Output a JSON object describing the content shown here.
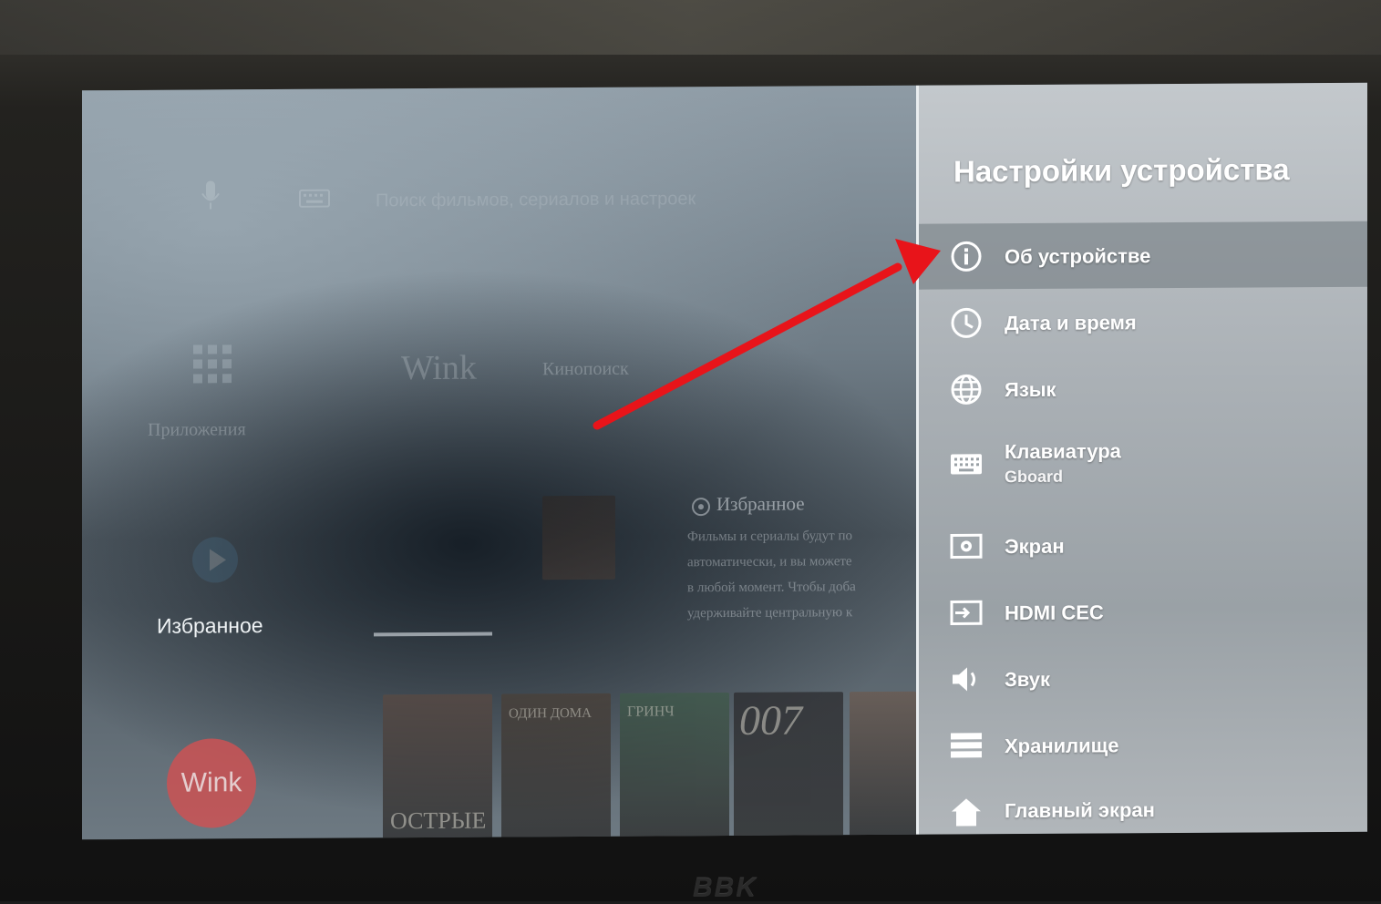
{
  "launcher": {
    "search_hint": "Поиск фильмов, сериалов и настроек",
    "apps_label": "Приложения",
    "row_title_wink": "Wink",
    "row_title_2": "Кинопоиск",
    "favorites_label": "Избранное",
    "favorites_panel": {
      "title": "Избранное",
      "description": "Фильмы и сериалы будут по\nавтоматически, и вы можете\nв любой момент. Чтобы доба\nудерживайте центральную к"
    },
    "posters": [
      {
        "name": "poster-1",
        "text": "ОСТРЫЕ",
        "color": "#5a4a43"
      },
      {
        "name": "poster-2",
        "text": "ОДИН ДОМА",
        "color": "#4a4038"
      },
      {
        "name": "poster-3",
        "text": "ГРИНЧ",
        "color": "#3f5a4a"
      },
      {
        "name": "poster-4",
        "text": "007",
        "color": "#2b2b2e"
      },
      {
        "name": "poster-5",
        "text": "",
        "color": "#6b5a50"
      }
    ],
    "wink_logo": "Wink"
  },
  "settings": {
    "title": "Настройки устройства",
    "items": [
      {
        "label": "Об устройстве",
        "icon": "info-icon",
        "active": true
      },
      {
        "label": "Дата и время",
        "icon": "clock-icon"
      },
      {
        "label": "Язык",
        "icon": "globe-icon"
      },
      {
        "label": "Клавиатура",
        "sub": "Gboard",
        "icon": "keyboard-icon"
      },
      {
        "label": "Экран",
        "icon": "screen-icon"
      },
      {
        "label": "HDMI CEC",
        "icon": "hdmi-icon"
      },
      {
        "label": "Звук",
        "icon": "speaker-icon"
      },
      {
        "label": "Хранилище",
        "icon": "storage-icon"
      },
      {
        "label": "Главный экран",
        "icon": "home-icon"
      }
    ]
  },
  "colors": {
    "annotation_arrow": "#e8141a",
    "wink_brand": "#c65456",
    "active_item": "#6e767c"
  },
  "monitor_brand": "BBK"
}
